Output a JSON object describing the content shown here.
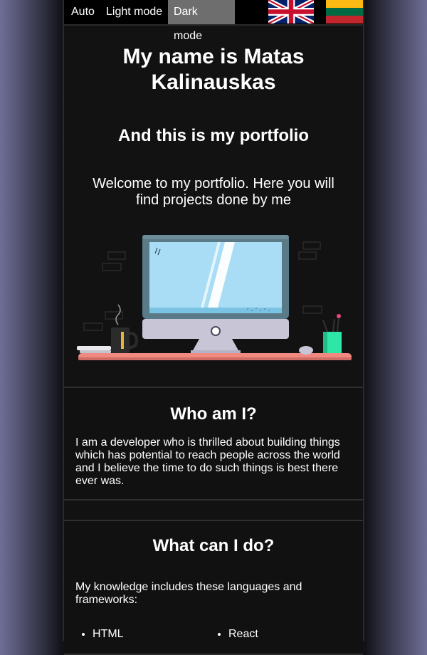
{
  "topbar": {
    "modes": [
      "Auto",
      "Light mode",
      "Dark mode"
    ],
    "active_mode": "Dark mode",
    "flags": [
      {
        "icon": "uk-flag-icon",
        "language": "English"
      },
      {
        "icon": "lithuania-flag-icon",
        "language": "Lithuanian"
      }
    ]
  },
  "hero": {
    "title": "My name is Matas Kalinauskas",
    "subtitle": "And this is my portfolio",
    "text": "Welcome to my portfolio. Here you will find projects done by me",
    "illustration": "desk-computer-illustration"
  },
  "about": {
    "title": "Who am I?",
    "text": "I am a developer who is thrilled about building things which has potential to reach people across the world and I believe the time to do such things is best there ever was."
  },
  "skills": {
    "title": "What can I do?",
    "text": "My knowledge includes these languages and frameworks:",
    "col1": [
      "HTML"
    ],
    "col2": [
      "React"
    ]
  },
  "colors": {
    "page_bg": "#121212",
    "active_mode_bg": "#6e6e6e",
    "accent_pink": "#f08a80"
  }
}
